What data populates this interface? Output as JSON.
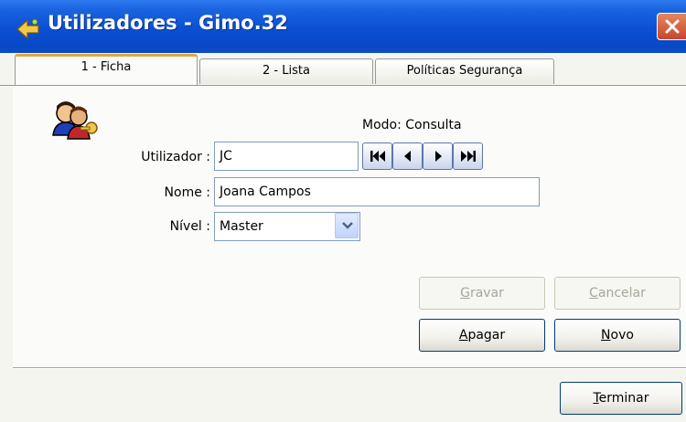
{
  "window": {
    "title": "Utilizadores - Gimo.32"
  },
  "tabs": [
    {
      "label": "1 - Ficha",
      "active": true
    },
    {
      "label": "2 - Lista",
      "active": false
    },
    {
      "label": "Políticas Segurança",
      "active": false
    }
  ],
  "mode": "Modo: Consulta",
  "form": {
    "utilizador_label": "Utilizador :",
    "utilizador_value": "JC",
    "nome_label": "Nome :",
    "nome_value": "Joana Campos",
    "nivel_label": "Nível :",
    "nivel_value": "Master"
  },
  "navigation": {
    "first": "first-record-icon",
    "previous": "previous-record-icon",
    "next": "next-record-icon",
    "last": "last-record-icon"
  },
  "buttons": {
    "gravar": {
      "mnemonic": "G",
      "rest": "ravar",
      "enabled": false
    },
    "cancelar": {
      "mnemonic": "C",
      "rest": "ancelar",
      "enabled": false
    },
    "apagar": {
      "mnemonic": "A",
      "rest": "pagar",
      "enabled": true
    },
    "novo": {
      "mnemonic": "N",
      "rest": "ovo",
      "enabled": true
    },
    "terminar": {
      "mnemonic": "T",
      "rest": "erminar",
      "enabled": true
    }
  },
  "colors": {
    "titlebar": "#0b4fd3",
    "active_tab_accent": "#e8a53c",
    "close_button": "#c8452b"
  }
}
